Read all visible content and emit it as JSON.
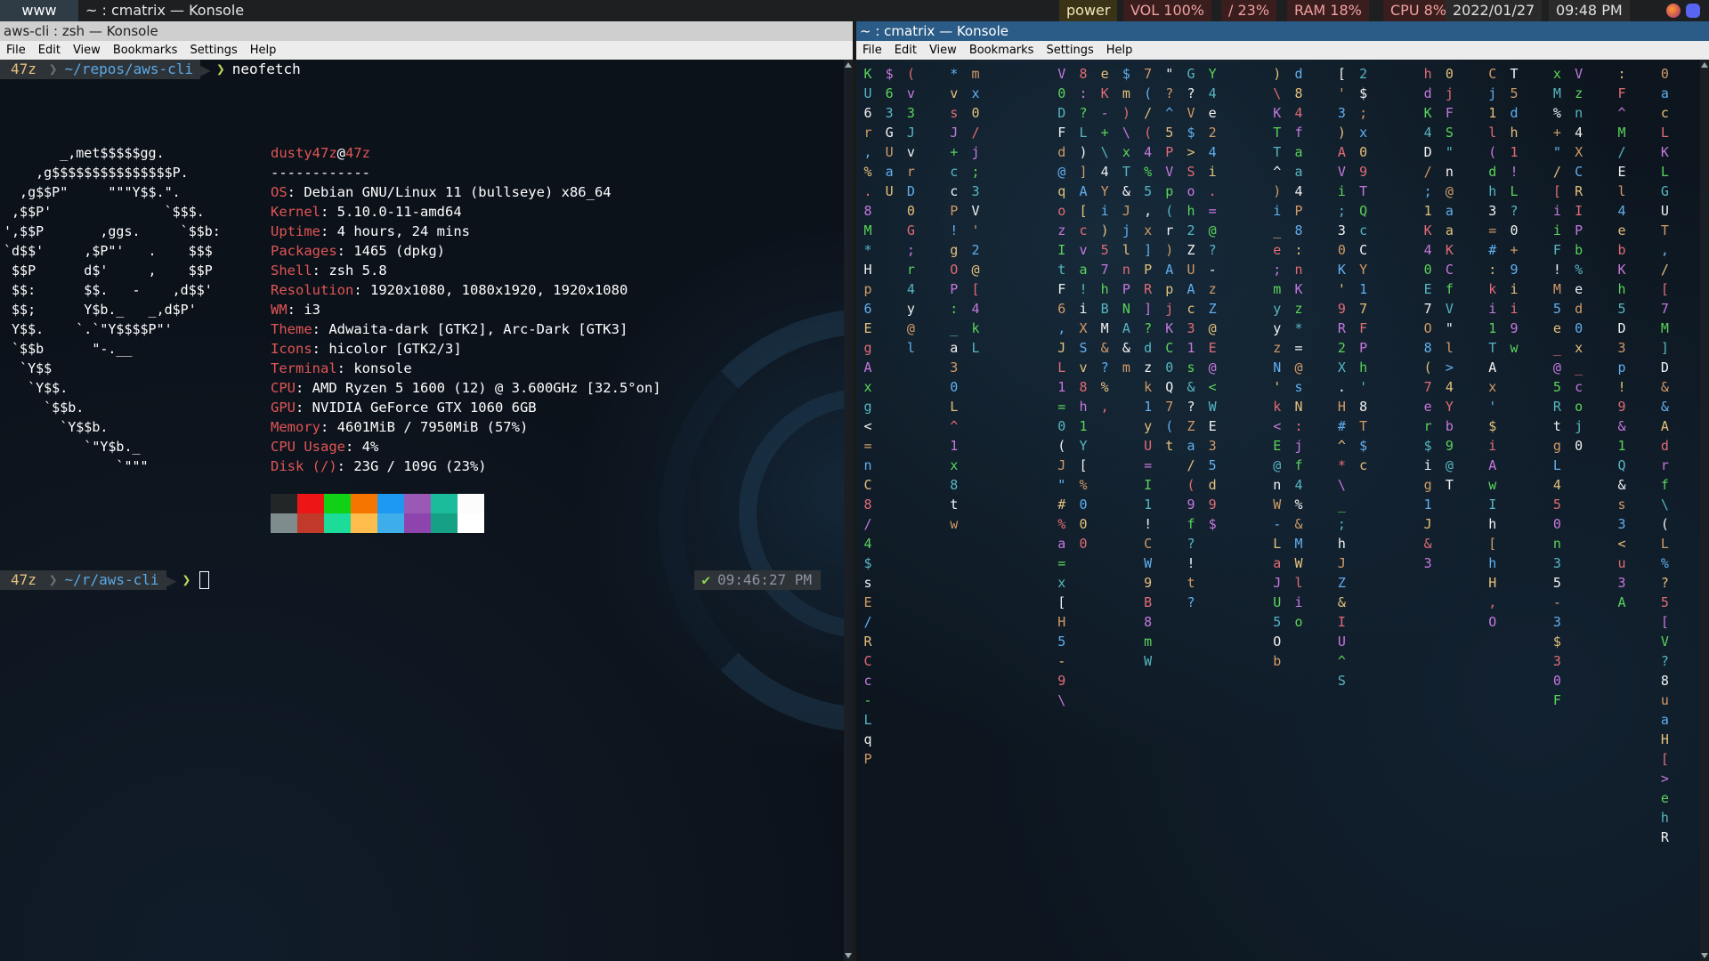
{
  "topbar": {
    "workspace": "www",
    "window_title": "~ : cmatrix — Konsole",
    "power_label": "power",
    "volume": "VOL 100%",
    "disk": "/ 23%",
    "ram": "RAM  18%",
    "cpu": "CPU   8%",
    "date": "2022/01/27",
    "time": "09:48 PM",
    "tray_icons": [
      "firefox-icon",
      "discord-icon"
    ]
  },
  "left_window": {
    "title": "aws-cli : zsh — Konsole",
    "menu": [
      "File",
      "Edit",
      "View",
      "Bookmarks",
      "Settings",
      "Help"
    ],
    "prompt1": {
      "user": "47z",
      "path": "~/repos/aws-cli",
      "command": "neofetch"
    },
    "prompt2": {
      "user": "47z",
      "path": "~/r/aws-cli",
      "command": ""
    },
    "right_prompt": {
      "status": "✔",
      "time": "09:46:27 PM"
    },
    "ascii_logo": [
      "       _,met$$$$$gg.",
      "    ,g$$$$$$$$$$$$$$$P.",
      "  ,g$$P\"     \"\"\"Y$$.\".",
      " ,$$P'              `$$$.",
      "',$$P       ,ggs.     `$$b:",
      "`d$$'     ,$P\"'   .    $$$",
      " $$P      d$'     ,    $$P",
      " $$:      $$.   -    ,d$$'",
      " $$;      Y$b._   _,d$P'",
      " Y$$.    `.`\"Y$$$$P\"'",
      " `$$b      \"-.__",
      "  `Y$$",
      "   `Y$$.",
      "     `$$b.",
      "       `Y$$b.",
      "          `\"Y$b._",
      "              `\"\"\""
    ],
    "neofetch": {
      "user": "dusty47z",
      "host": "47z",
      "separator": "------------",
      "rows": [
        {
          "key": "OS",
          "value": "Debian GNU/Linux 11 (bullseye) x86_64"
        },
        {
          "key": "Kernel",
          "value": "5.10.0-11-amd64"
        },
        {
          "key": "Uptime",
          "value": "4 hours, 24 mins"
        },
        {
          "key": "Packages",
          "value": "1465 (dpkg)"
        },
        {
          "key": "Shell",
          "value": "zsh 5.8"
        },
        {
          "key": "Resolution",
          "value": "1920x1080, 1080x1920, 1920x1080"
        },
        {
          "key": "WM",
          "value": "i3"
        },
        {
          "key": "Theme",
          "value": "Adwaita-dark [GTK2], Arc-Dark [GTK3]"
        },
        {
          "key": "Icons",
          "value": "hicolor [GTK2/3]"
        },
        {
          "key": "Terminal",
          "value": "konsole"
        },
        {
          "key": "CPU",
          "value": "AMD Ryzen 5 1600 (12) @ 3.600GHz [32.5°on]"
        },
        {
          "key": "GPU",
          "value": "NVIDIA GeForce GTX 1060 6GB"
        },
        {
          "key": "Memory",
          "value": "4601MiB / 7950MiB (57%)"
        },
        {
          "key": "CPU Usage",
          "value": "4%"
        },
        {
          "key": "Disk (/)",
          "value": "23G / 109G (23%)"
        }
      ],
      "palette_top": [
        "#232627",
        "#ed1515",
        "#11d116",
        "#f67400",
        "#1d99f3",
        "#9b59b6",
        "#1abc9c",
        "#fcfcfc"
      ],
      "palette_bottom": [
        "#7f8c8d",
        "#c0392b",
        "#1cdc9a",
        "#fdbc4b",
        "#3daee9",
        "#8e44ad",
        "#16a085",
        "#ffffff"
      ]
    }
  },
  "right_window": {
    "title": "~ : cmatrix — Konsole",
    "menu": [
      "File",
      "Edit",
      "View",
      "Bookmarks",
      "Settings",
      "Help"
    ],
    "matrix_colors": [
      "#5ad45a",
      "#e5c07b",
      "#f2f2f2",
      "#c678dd",
      "#61afef",
      "#56b6c2",
      "#e06c75",
      "#d19a66"
    ],
    "matrix_columns": [
      "K U 6 r , % . 8 M * H p 6 E g A x g < = n C 8 / 4 $ s E / R C c - L q P",
      "$ 6 3 G U a U",
      "( v 3 J v r D 0 G ; r 4 y @ l",
      "",
      "* v s J + c c P ! g O P : _ a 3 0 L ^ 1 x 8 t w",
      "m x 0 / j ; 3 V ' 2 @ [ 4 k L",
      "",
      "",
      "",
      "V 0 D F d @ q o z I t F 6 , J L 1 = 0 ( J \" # % a = x [ H 5 - 9 \\",
      "8 : ? L ) ] A [ c v a ! i X S v 8 h 1 Y [ % 0 0 0",
      "e K - + \\ 4 Y i ) 5 7 h B M & ? % ,",
      "$ m ) \\ x T & J j l n P N A & m",
      "7 ( / ( 4 % 5 , x ] P R ] ? d z k 1 y U = I 1 ! C W 9 B 8 m W",
      "\" ? ^ 5 P V p ( r ) A p j K C 0 Q 7 ( t",
      "G ? V $ > S o h 2 Z U A c 3 1 s & ? Z a / ( 9 f ? ! t ?",
      "Y 4 e 2 4 i . = @ ? - z Z @ E @ < W E 3 5 d 9 $",
      "",
      "",
      ") \\ K T T ^ ) i _ e ; m y y z N ' k < E @ n W - L a J U 5 O b",
      "d 8 4 f a a 4 P 8 : n K z * = @ s N : j f 4 % & M W l i o",
      "",
      "[ ' 3 ) A V i ; 3 0 K ' 9 R 2 X . H # ^ * \\ _ ; h J Z & I U ^ S",
      "2 $ ; x 0 9 T Q c C Y 1 7 F P h ' 8 T $ c",
      "",
      "",
      "h d K 4 D / ; 1 K 4 0 E 7 O 8 ( 7 e r $ i g 1 J & 3",
      "0 j F S \" n @ a a K C f V \" l > 4 Y b 9 @ T",
      "",
      "C j 1 l ( d h 3 = # : k i 1 T A x ' $ i A w I h [ h H , O",
      "T 5 d h 1 ! L ? 0 + 9 i i 9 w",
      "",
      "x M % + \" / [ i i F ! M 5 e _ @ 5 R t g L 4 5 0 n 3 5 - 3 $ 3 0 F",
      "V z n 4 X C R I P b % e d 0 x _ c o j 0",
      "",
      ": F ^ M / E l 4 e b K h 5 D 3 p ! 9 & 1 Q & s 3 < u 3 A",
      "",
      "0 a c L K L G U T , / [ 7 M ] D & & A d r f \\ ( L % ? 5 [ V ? 8 u a H [ > e h R"
    ]
  }
}
